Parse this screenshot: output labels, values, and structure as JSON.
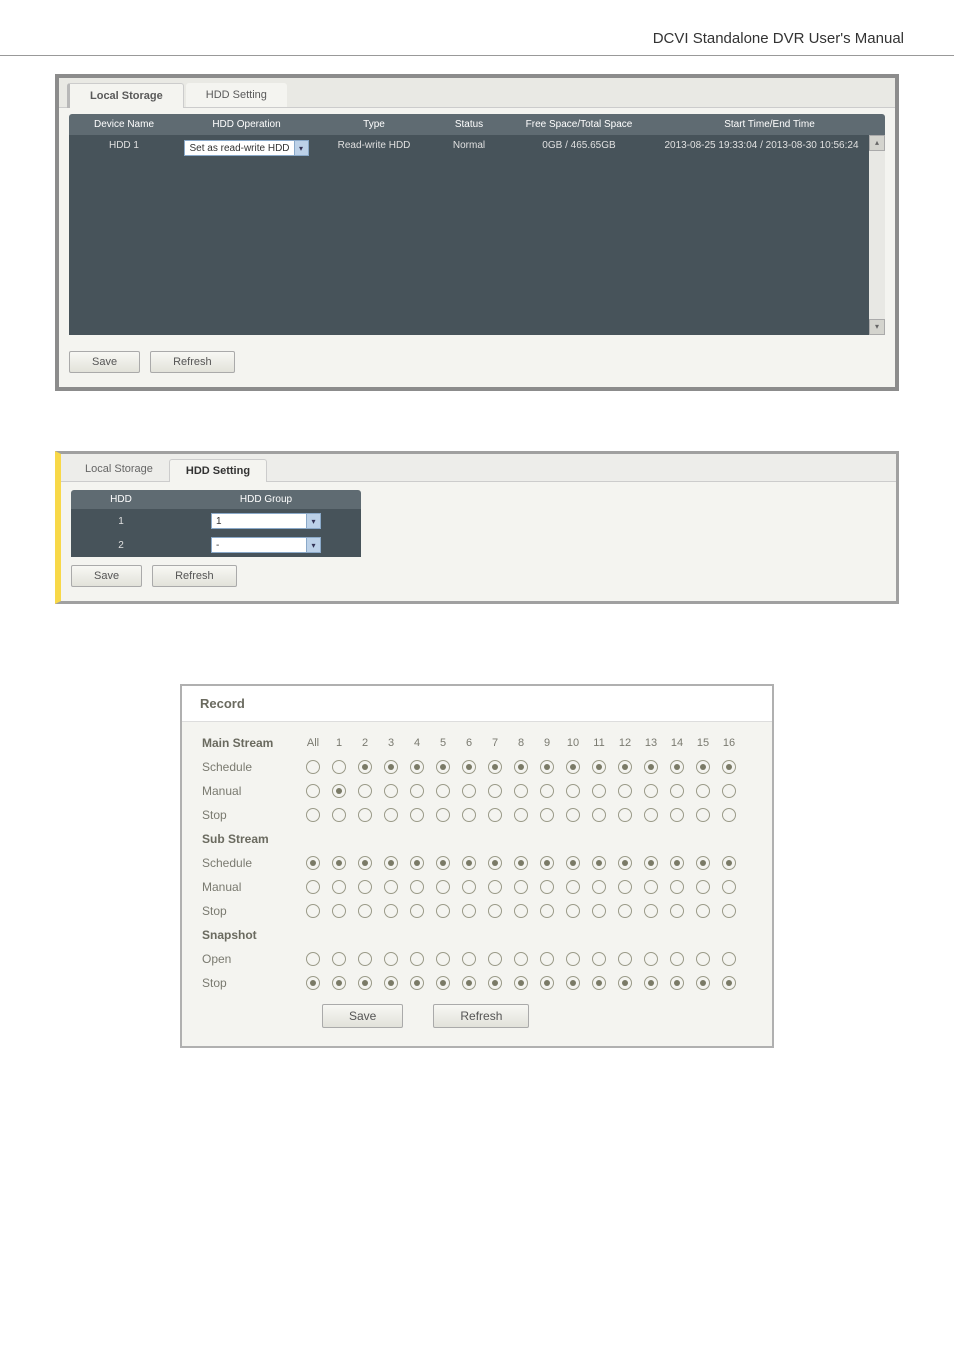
{
  "header": {
    "title": "DCVI Standalone DVR User's Manual"
  },
  "panel1": {
    "tabs": [
      "Local Storage",
      "HDD Setting"
    ],
    "active_tab": 0,
    "columns": {
      "device_name": "Device Name",
      "hdd_operation": "HDD Operation",
      "type": "Type",
      "status": "Status",
      "free_space": "Free Space/Total Space",
      "start_end": "Start Time/End Time"
    },
    "rows": [
      {
        "device_name": "HDD 1",
        "hdd_operation": "Set as read-write HDD",
        "type": "Read-write HDD",
        "status": "Normal",
        "free_space": "0GB / 465.65GB",
        "start_end": "2013-08-25 19:33:04 / 2013-08-30 10:56:24"
      }
    ],
    "buttons": {
      "save": "Save",
      "refresh": "Refresh"
    }
  },
  "panel2": {
    "tabs": [
      "Local Storage",
      "HDD Setting"
    ],
    "active_tab": 1,
    "columns": {
      "hdd": "HDD",
      "hdd_group": "HDD Group"
    },
    "rows": [
      {
        "hdd": "1",
        "hdd_group": "1"
      },
      {
        "hdd": "2",
        "hdd_group": "-"
      }
    ],
    "buttons": {
      "save": "Save",
      "refresh": "Refresh"
    }
  },
  "panel3": {
    "title": "Record",
    "channel_header": [
      "All",
      "1",
      "2",
      "3",
      "4",
      "5",
      "6",
      "7",
      "8",
      "9",
      "10",
      "11",
      "12",
      "13",
      "14",
      "15",
      "16"
    ],
    "groups": [
      {
        "name": "Main Stream",
        "rows": [
          {
            "label": "Schedule",
            "sel": [
              false,
              false,
              true,
              true,
              true,
              true,
              true,
              true,
              true,
              true,
              true,
              true,
              true,
              true,
              true,
              true,
              true
            ]
          },
          {
            "label": "Manual",
            "sel": [
              false,
              true,
              false,
              false,
              false,
              false,
              false,
              false,
              false,
              false,
              false,
              false,
              false,
              false,
              false,
              false,
              false
            ]
          },
          {
            "label": "Stop",
            "sel": [
              false,
              false,
              false,
              false,
              false,
              false,
              false,
              false,
              false,
              false,
              false,
              false,
              false,
              false,
              false,
              false,
              false
            ]
          }
        ]
      },
      {
        "name": "Sub Stream",
        "rows": [
          {
            "label": "Schedule",
            "sel": [
              true,
              true,
              true,
              true,
              true,
              true,
              true,
              true,
              true,
              true,
              true,
              true,
              true,
              true,
              true,
              true,
              true
            ]
          },
          {
            "label": "Manual",
            "sel": [
              false,
              false,
              false,
              false,
              false,
              false,
              false,
              false,
              false,
              false,
              false,
              false,
              false,
              false,
              false,
              false,
              false
            ]
          },
          {
            "label": "Stop",
            "sel": [
              false,
              false,
              false,
              false,
              false,
              false,
              false,
              false,
              false,
              false,
              false,
              false,
              false,
              false,
              false,
              false,
              false
            ]
          }
        ]
      },
      {
        "name": "Snapshot",
        "rows": [
          {
            "label": "Open",
            "sel": [
              false,
              false,
              false,
              false,
              false,
              false,
              false,
              false,
              false,
              false,
              false,
              false,
              false,
              false,
              false,
              false,
              false
            ]
          },
          {
            "label": "Stop",
            "sel": [
              true,
              true,
              true,
              true,
              true,
              true,
              true,
              true,
              true,
              true,
              true,
              true,
              true,
              true,
              true,
              true,
              true
            ]
          }
        ]
      }
    ],
    "buttons": {
      "save": "Save",
      "refresh": "Refresh"
    }
  }
}
